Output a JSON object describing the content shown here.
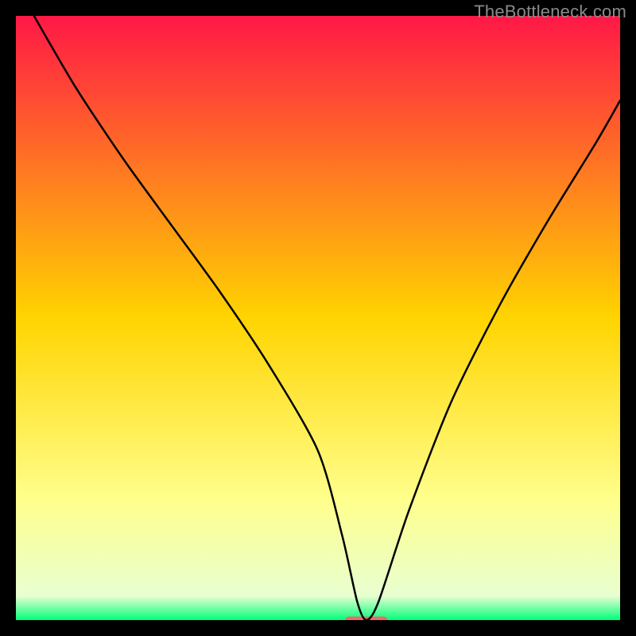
{
  "watermark": "TheBottleneck.com",
  "chart_data": {
    "type": "line",
    "title": "",
    "xlabel": "",
    "ylabel": "",
    "xlim": [
      0,
      100
    ],
    "ylim": [
      0,
      100
    ],
    "background_gradient": {
      "stops": [
        {
          "offset": 0,
          "color": "#ff1846"
        },
        {
          "offset": 50,
          "color": "#ffd400"
        },
        {
          "offset": 80,
          "color": "#ffff8c"
        },
        {
          "offset": 96,
          "color": "#e8ffd0"
        },
        {
          "offset": 100,
          "color": "#00ff7a"
        }
      ]
    },
    "series": [
      {
        "name": "curve",
        "color": "#000000",
        "x": [
          3,
          10,
          18,
          26,
          34,
          42,
          50,
          54,
          56.5,
          58,
          60,
          65,
          72,
          80,
          88,
          96,
          100
        ],
        "y": [
          100,
          88,
          76,
          65,
          54,
          42,
          28,
          14,
          3,
          0,
          3,
          18,
          36,
          52,
          66,
          79,
          86
        ]
      }
    ],
    "marker": {
      "name": "optimum-marker",
      "color": "#e96a6a",
      "x": 58,
      "y": 0,
      "width_pct": 7,
      "height_pct": 1.2
    }
  }
}
